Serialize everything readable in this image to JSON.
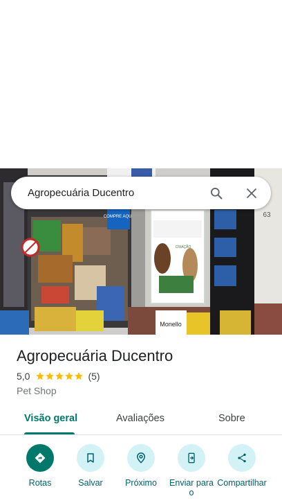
{
  "search": {
    "query": "Agropecuária Ducentro"
  },
  "photo": {
    "signs": {
      "sale_badge": "COMPRE AQUI",
      "store_front": "Monello",
      "poster_small": "CRIAÇÃO",
      "side_number": "63"
    }
  },
  "place": {
    "name": "Agropecuária Ducentro",
    "rating": "5,0",
    "rating_value": 5.0,
    "review_count": "(5)",
    "category": "Pet Shop"
  },
  "tabs": [
    {
      "label": "Visão geral",
      "active": true
    },
    {
      "label": "Avaliações",
      "active": false
    },
    {
      "label": "Sobre",
      "active": false
    }
  ],
  "actions": [
    {
      "label": "Rotas",
      "icon": "directions-icon"
    },
    {
      "label": "Salvar",
      "icon": "bookmark-icon"
    },
    {
      "label": "Próximo",
      "icon": "nearby-icon"
    },
    {
      "label": "Enviar para o",
      "icon": "send-to-phone-icon"
    },
    {
      "label": "Compartilhar",
      "icon": "share-icon"
    }
  ],
  "colors": {
    "accent": "#00796b",
    "action_bg": "#d3f2f6",
    "star": "#fbbc04"
  }
}
